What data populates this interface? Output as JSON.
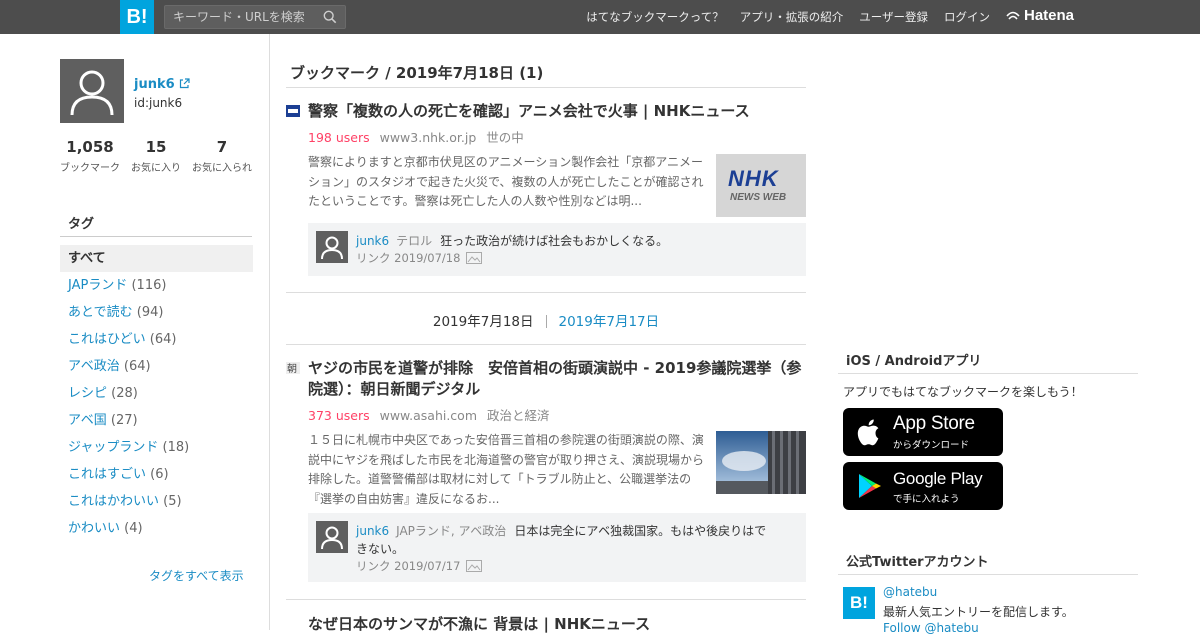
{
  "header": {
    "logo": "B!",
    "search_placeholder": "キーワード・URLを検索",
    "nav": [
      "はてなブックマークって？",
      "アプリ・拡張の紹介",
      "ユーザー登録",
      "ログイン"
    ],
    "hatena_label": "Hatena"
  },
  "profile": {
    "name": "junk6",
    "id": "id:junk6",
    "stats": [
      {
        "num": "1,058",
        "label": "ブックマーク"
      },
      {
        "num": "15",
        "label": "お気に入り"
      },
      {
        "num": "7",
        "label": "お気に入られ"
      }
    ]
  },
  "tags": {
    "title": "タグ",
    "items": [
      {
        "name": "すべて",
        "count": ""
      },
      {
        "name": "JAPランド",
        "count": "(116)"
      },
      {
        "name": "あとで読む",
        "count": "(94)"
      },
      {
        "name": "これはひどい",
        "count": "(64)"
      },
      {
        "name": "アベ政治",
        "count": "(64)"
      },
      {
        "name": "レシピ",
        "count": "(28)"
      },
      {
        "name": "アベ国",
        "count": "(27)"
      },
      {
        "name": "ジャップランド",
        "count": "(18)"
      },
      {
        "name": "これはすごい",
        "count": "(6)"
      },
      {
        "name": "これはかわいい",
        "count": "(5)"
      },
      {
        "name": "かわいい",
        "count": "(4)"
      }
    ],
    "show_all": "タグをすべて表示"
  },
  "main": {
    "day_header": "ブックマーク / 2019年7月18日 (1)",
    "entries": [
      {
        "title": "警察「複数の人の死亡を確認」アニメ会社で火事 | NHKニュース",
        "users": "198 users",
        "domain": "www3.nhk.or.jp",
        "category": "世の中",
        "description": "警察によりますと京都市伏見区のアニメーション製作会社「京都アニメーション」のスタジオで起きた火災で、複数の人が死亡したことが確認されたということです。警察は死亡した人の人数や性別などは明...",
        "thumb_text_1": "NHK",
        "thumb_text_2": "NEWS WEB",
        "comment_user": "junk6",
        "comment_tags": "テロル",
        "comment_text": "狂った政治が続けば社会もおかしくなる。",
        "comment_link": "リンク 2019/07/18"
      },
      {
        "title": "ヤジの市民を道警が排除　安倍首相の街頭演説中 - 2019参議院選挙（参院選）：朝日新聞デジタル",
        "users": "373 users",
        "domain": "www.asahi.com",
        "category": "政治と経済",
        "description": "１５日に札幌市中央区であった安倍晋三首相の参院選の街頭演説の際、演説中にヤジを飛ばした市民を北海道警の警官が取り押さえ、演説現場から排除した。道警警備部は取材に対して「トラブル防止と、公職選挙法の『選挙の自由妨害』違反になるお...",
        "comment_user": "junk6",
        "comment_tags": "JAPランド, アベ政治",
        "comment_text": "日本は完全にアベ独裁国家。もはや後戻りはできない。",
        "comment_link": "リンク 2019/07/17"
      },
      {
        "title": "なぜ日本のサンマが不漁に 背景は | NHKニュース"
      }
    ],
    "date_nav": {
      "current": "2019年7月18日",
      "prev": "2019年7月17日"
    }
  },
  "right": {
    "app_title": "iOS / Androidアプリ",
    "app_text": "アプリでもはてなブックマークを楽しもう！",
    "appstore_big": "App Store",
    "appstore_small": "からダウンロード",
    "gplay_big": "Google Play",
    "gplay_small": "で手に入れよう",
    "twitter_title": "公式Twitterアカウント",
    "twitter_logo": "B!",
    "twitter_name": "@hatebu",
    "twitter_desc": "最新人気エントリーを配信します。",
    "twitter_follow": "Follow @hatebu"
  },
  "colors": {
    "brand": "#00a4de",
    "link": "#1a8cc4",
    "users": "#ff4166",
    "topbar": "#4d4d4d"
  }
}
